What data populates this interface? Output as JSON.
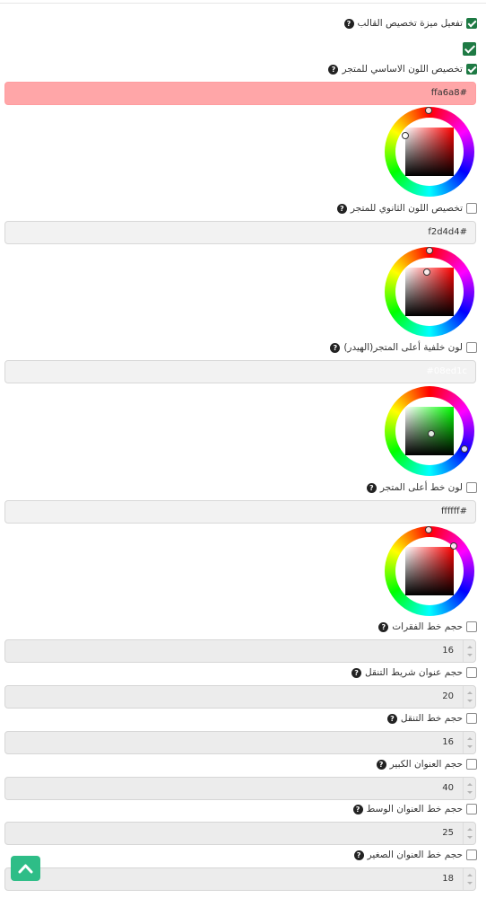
{
  "options": {
    "enable_customization": "تفعيل ميزة تخصيص القالب",
    "primary_color": "تخصيص اللون الاساسي للمتجر",
    "secondary_color": "تخصيص اللون الثانوي للمتجر",
    "header_bg": "لون خلفية أعلى المتجر(الهيدر)",
    "header_text": "لون خط أعلى المتجر",
    "paragraph_size": "حجم خط الفقرات",
    "navbar_title_size": "حجم عنوان شريط التنقل",
    "nav_font_size": "حجم خط التنقل",
    "big_title_size": "حجم العنوان الكبير",
    "mid_title_size": "حجم خط العنوان الوسط",
    "small_title_size": "حجم خط العنوان الصغير"
  },
  "colors": {
    "primary": "#ffa6a8",
    "secondary": "#f2d4d4",
    "header_bg": "#ffffff",
    "header_text": "#ffffff"
  },
  "color_inputs": {
    "primary": "ffa6a8#",
    "secondary": "f2d4d4#",
    "header_bg": "#08ed1c",
    "header_text": "ffffff#"
  },
  "numbers": {
    "paragraph": "16",
    "navbar_title": "20",
    "nav": "16",
    "big_title": "40",
    "mid_title": "25",
    "small_title": "18"
  },
  "icons": {
    "help": "question-circle-icon",
    "back_to_top": "chevron-up-icon"
  }
}
